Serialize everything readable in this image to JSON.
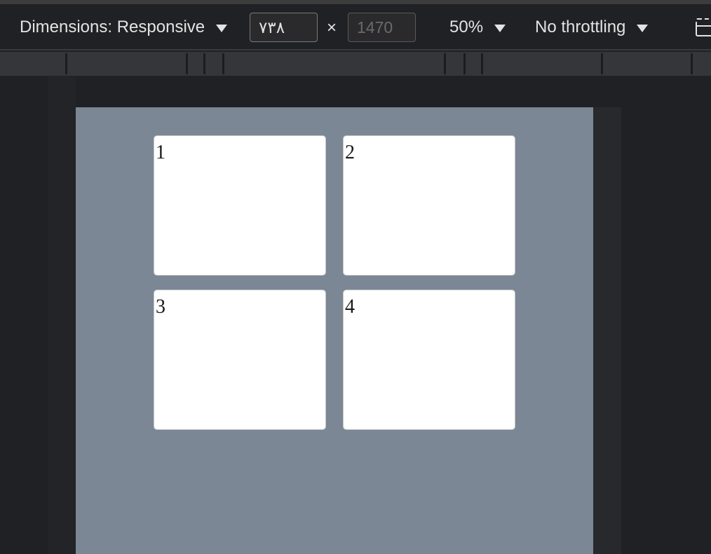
{
  "toolbar": {
    "dimensions_label": "Dimensions: Responsive",
    "width_value": "٧٣٨",
    "height_placeholder": "1470",
    "times_symbol": "×",
    "zoom_label": "50%",
    "throttling_label": "No throttling",
    "device_toggle_icon": "device-mode-icon"
  },
  "page": {
    "background_color": "#7b8794",
    "cards": [
      {
        "label": "1"
      },
      {
        "label": "2"
      },
      {
        "label": "3"
      },
      {
        "label": "4"
      }
    ]
  }
}
